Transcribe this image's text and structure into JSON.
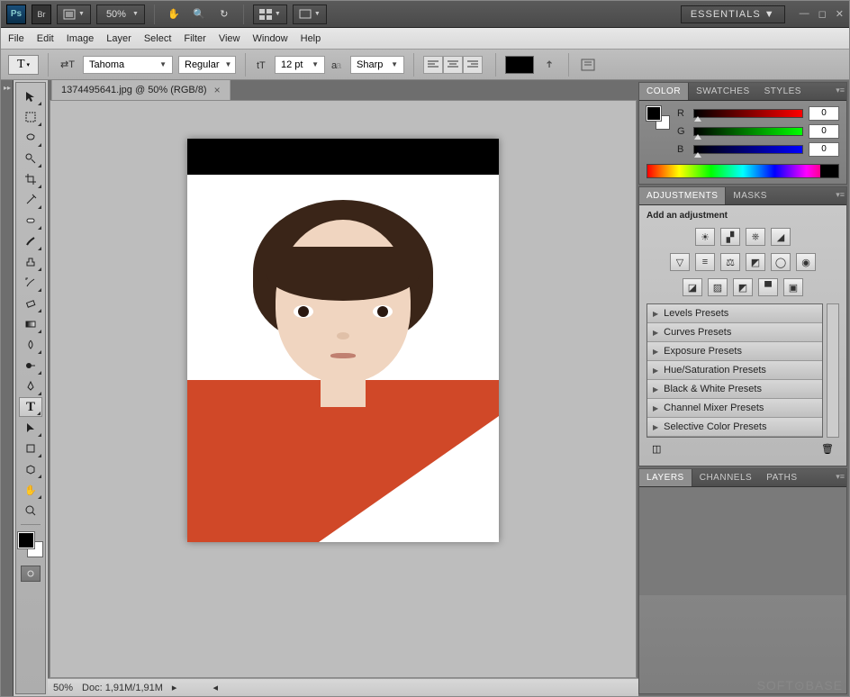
{
  "topbar": {
    "zoom": "50%",
    "workspace": "ESSENTIALS"
  },
  "menu": [
    "File",
    "Edit",
    "Image",
    "Layer",
    "Select",
    "Filter",
    "View",
    "Window",
    "Help"
  ],
  "options": {
    "font_family": "Tahoma",
    "font_style": "Regular",
    "font_size": "12 pt",
    "aa_mode": "Sharp"
  },
  "document": {
    "tab_title": "1374495641.jpg @ 50% (RGB/8)",
    "status_zoom": "50%",
    "status_doc": "Doc: 1,91M/1,91M"
  },
  "color_panel": {
    "tabs": [
      "COLOR",
      "SWATCHES",
      "STYLES"
    ],
    "channels": [
      {
        "label": "R",
        "value": "0"
      },
      {
        "label": "G",
        "value": "0"
      },
      {
        "label": "B",
        "value": "0"
      }
    ]
  },
  "adjustments_panel": {
    "tabs": [
      "ADJUSTMENTS",
      "MASKS"
    ],
    "heading": "Add an adjustment",
    "presets": [
      "Levels Presets",
      "Curves Presets",
      "Exposure Presets",
      "Hue/Saturation Presets",
      "Black & White Presets",
      "Channel Mixer Presets",
      "Selective Color Presets"
    ]
  },
  "layers_panel": {
    "tabs": [
      "LAYERS",
      "CHANNELS",
      "PATHS"
    ]
  },
  "watermark": "SOFT⊙BASE"
}
